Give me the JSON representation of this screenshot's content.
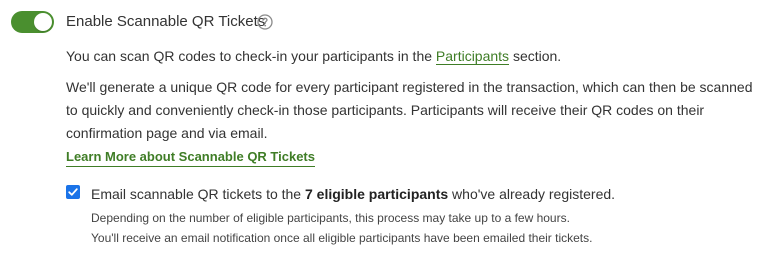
{
  "toggle": {
    "state": "on",
    "color": "#4a8f2f"
  },
  "header": {
    "label": "Enable Scannable QR Tickets",
    "help_icon": "question-circle-icon"
  },
  "intro": {
    "before": "You can scan QR codes to check-in your participants in the ",
    "link": "Participants",
    "after": " section."
  },
  "description": "We'll generate a unique QR code for every participant registered in the transaction, which can then be scanned to quickly and conveniently check-in those participants. Participants will receive their QR codes on their confirmation page and via email.",
  "learn_more": "Learn More about Scannable QR Tickets",
  "email_option": {
    "checked": true,
    "before": "Email scannable QR tickets to the ",
    "bold": "7 eligible participants",
    "after": " who've already registered.",
    "note1": "Depending on the number of eligible participants, this process may take up to a few hours.",
    "note2": "You'll receive an email notification once all eligible participants have been emailed their tickets."
  },
  "colors": {
    "link": "#3f7d26",
    "checkbox": "#1a73e8",
    "text": "#333333"
  }
}
